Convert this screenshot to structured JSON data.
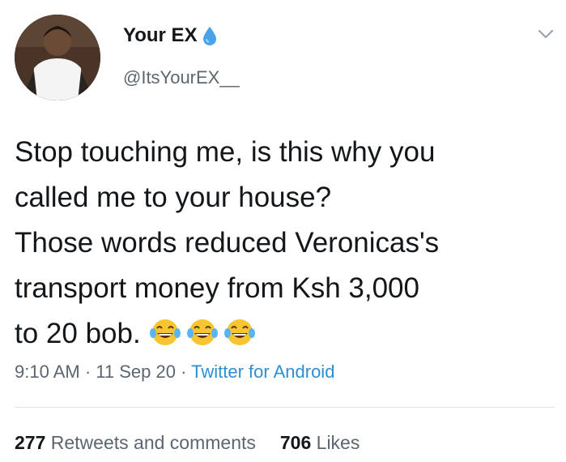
{
  "user": {
    "display_name": "Your EX",
    "handle": "@ItsYourEX__",
    "verified_badge_icon": "water-drop-icon"
  },
  "tweet": {
    "lines": [
      "Stop touching me, is this why you",
      "called me to your house?",
      "Those words reduced Veronicas's",
      "transport money from Ksh 3,000",
      "to 20 bob."
    ],
    "emoji_icons": [
      "laughing-tears-emoji",
      "laughing-tears-emoji",
      "laughing-tears-emoji"
    ]
  },
  "meta": {
    "time": "9:10 AM",
    "date": "11 Sep 20",
    "separator": " · ",
    "source": "Twitter for Android"
  },
  "stats": {
    "retweets_count": "277",
    "retweets_label": "Retweets and comments",
    "likes_count": "706",
    "likes_label": "Likes"
  },
  "colors": {
    "text": "#14171a",
    "muted": "#5b6670",
    "link": "#2b8fd4"
  }
}
